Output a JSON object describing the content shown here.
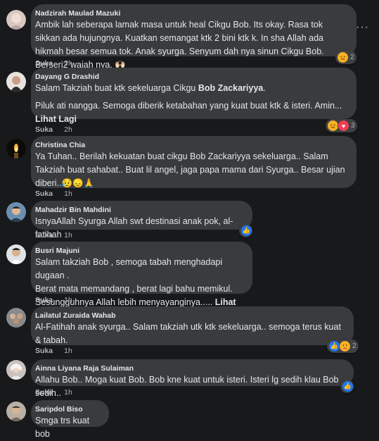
{
  "comments": [
    {
      "author": "Nadzirah Maulad Mazuki",
      "text": "Ambik lah seberapa lamak masa untuk heal Cikgu Bob. Its okay. Rasa tok sikkan ada hujungnya. Kuatkan semangat ktk 2 bini ktk k. In sha Allah ada hikmah besar semua tok. Anak syurga. Senyum dah nya sinun Cikgu Bob. Berseri2 wajah nya. 🙌🏻",
      "like": "Suka",
      "time": "2h",
      "reactions": [
        "sad"
      ],
      "reaction_count": "2"
    },
    {
      "author": "Dayang G Drashid",
      "text_a": "Salam Takziah buat ktk sekeluarga Cikgu ",
      "text_bold": "Bob Zackariyya",
      "text_b": ".",
      "text2": "Piluk ati nangga. Semoga diberik ketabahan yang kuat buat ktk & isteri. Amin...",
      "see_more": "Lihat Lagi",
      "like": "Suka",
      "time": "2h",
      "reactions": [
        "sad",
        "love"
      ],
      "reaction_count": "3"
    },
    {
      "author": "Christina Chia",
      "text": "Ya Tuhan.. Berilah kekuatan buat cikgu Bob Zackariyya sekeluarga.. Salam Takziah buat sahabat.. Buat lil angel, jaga papa mama dari Syurga.. Besar ujian diberi..😥😞🙏",
      "like": "Suka",
      "time": "1h"
    },
    {
      "author": "Mahadzir Bin Mahdini",
      "text": "IsnyaAllah Syurga Allah swt destinasi anak pok, al-fatihah",
      "like": "Suka",
      "time": "1h",
      "reactions": [
        "like"
      ],
      "reaction_count": ""
    },
    {
      "author": "Busri Majuni",
      "text": "Salam takziah Bob , semoga tabah menghadapi dugaan .\nBerat mata memandang , berat lagi bahu memikul.\nSesungguhnya Allah lebih menyayanginya..... ",
      "see_more": "Lihat Lagi",
      "like": "Suka",
      "time": "1h"
    },
    {
      "author": "Lailatul Zuraida Wahab",
      "text": "Al-Fatihah anak syurga.. Salam takziah utk ktk sekeluarga.. semoga terus kuat & tabah.",
      "like": "Suka",
      "time": "1h",
      "reactions": [
        "like",
        "care"
      ],
      "reaction_count": "2"
    },
    {
      "author": "Ainna Liyana Raja Sulaiman",
      "text": "Allahu Bob.. Moga kuat Bob. Bob kne kuat untuk isteri. Isteri lg sedih klau Bob sedih..",
      "like": "Suka",
      "time": "1h",
      "reactions": [
        "like"
      ],
      "reaction_count": ""
    },
    {
      "author": "Saripdol Biso",
      "text": "Smga trs kuat bob"
    }
  ],
  "icons": {
    "more": "more-horizontal-icon",
    "sad": "sad-reaction-icon",
    "love": "love-reaction-icon",
    "like": "like-reaction-icon",
    "care": "care-reaction-icon"
  },
  "colors": {
    "background": "#18191a",
    "bubble": "#3a3b3c",
    "text": "#e4e6eb",
    "secondary": "#b0b3b8",
    "like_blue": "#2078f4",
    "sad_yellow": "#f7b125",
    "love_red": "#f33e58"
  }
}
